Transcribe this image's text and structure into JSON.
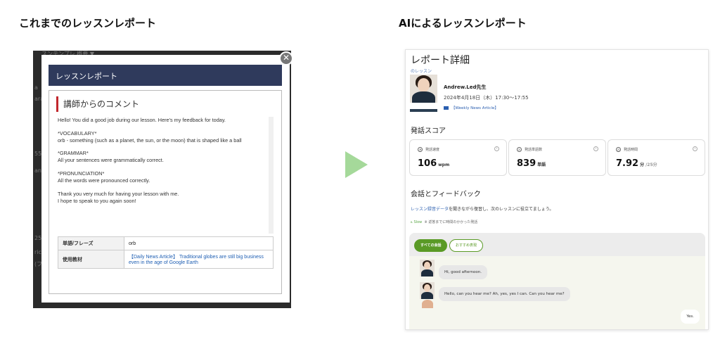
{
  "headings": {
    "left": "これまでのレッスンレポート",
    "right": "AIによるレッスンレポート"
  },
  "old_report": {
    "background_fragments": [
      "スンテンプレ 概要 ▼",
      "a",
      "ara",
      "55",
      "ani",
      "25",
      "ric",
      "(フ"
    ],
    "modal_title": "レッスンレポート",
    "close_icon": "close-icon",
    "comment_title": "講師からのコメント",
    "comment_paragraphs": [
      "Hello! You did a good job during our lesson. Here's my feedback for today.",
      "*VOCABULARY*\norb - something (such as a planet, the sun, or the moon) that is shaped like a ball",
      "*GRAMMAR*\nAll your sentences were grammatically correct.",
      "*PRONUNCIATION*\nAll the words were pronounced correctly.",
      "Thank you very much for having your lesson with me.\nI hope to speak to you again soon!"
    ],
    "table": [
      {
        "label": "単語/フレーズ",
        "value": "orb"
      },
      {
        "label": "使用教材",
        "value": "【Daily News Article】 Traditional globes are still big business even in the age of Google Earth"
      }
    ]
  },
  "arrow_color": "#a5d99a",
  "ai_report": {
    "title": "レポート詳細",
    "subtitle": "のレッスン",
    "teacher_name": "Andrew.Led先生",
    "lesson_datetime": "2024年4月18日（木）17:30〜17:55",
    "material": "【Weekly News Article】",
    "speaking_score_title": "発話スコア",
    "scores": [
      {
        "label": "発話速度",
        "value": "106",
        "unit": "wpm",
        "sub": ""
      },
      {
        "label": "発話単語数",
        "value": "839",
        "unit": "単語",
        "sub": ""
      },
      {
        "label": "発話時間",
        "value": "7.92",
        "unit": "分",
        "sub": "/25分"
      }
    ],
    "feedback_title": "会話とフィードバック",
    "feedback_desc_link": "レッスン録音データ",
    "feedback_desc_rest": "を聞きながら復習し、次のレッスンに役立てましょう。",
    "slow_label": "Slow",
    "slow_note": "※ 返答までに時間のかかった発話",
    "tabs": [
      "すべての会話",
      "おすすめ表現"
    ],
    "messages": [
      "Hi, good afternoon.",
      "Hello, can you hear me? Ah, yes, yes I can. Can you hear me?",
      "Yes."
    ],
    "accent_color": "#5a9a26"
  }
}
